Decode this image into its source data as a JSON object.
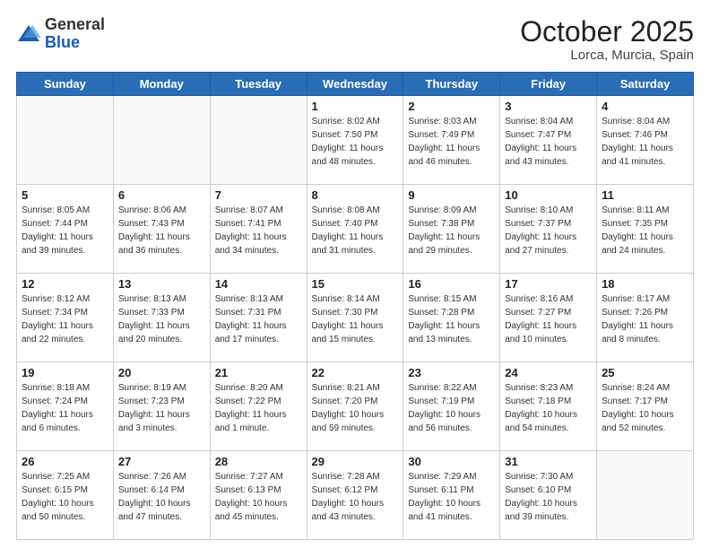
{
  "header": {
    "logo_general": "General",
    "logo_blue": "Blue",
    "month_title": "October 2025",
    "subtitle": "Lorca, Murcia, Spain"
  },
  "days_of_week": [
    "Sunday",
    "Monday",
    "Tuesday",
    "Wednesday",
    "Thursday",
    "Friday",
    "Saturday"
  ],
  "weeks": [
    [
      {
        "day": "",
        "sunrise": "",
        "sunset": "",
        "daylight": ""
      },
      {
        "day": "",
        "sunrise": "",
        "sunset": "",
        "daylight": ""
      },
      {
        "day": "",
        "sunrise": "",
        "sunset": "",
        "daylight": ""
      },
      {
        "day": "1",
        "sunrise": "Sunrise: 8:02 AM",
        "sunset": "Sunset: 7:50 PM",
        "daylight": "Daylight: 11 hours and 48 minutes."
      },
      {
        "day": "2",
        "sunrise": "Sunrise: 8:03 AM",
        "sunset": "Sunset: 7:49 PM",
        "daylight": "Daylight: 11 hours and 46 minutes."
      },
      {
        "day": "3",
        "sunrise": "Sunrise: 8:04 AM",
        "sunset": "Sunset: 7:47 PM",
        "daylight": "Daylight: 11 hours and 43 minutes."
      },
      {
        "day": "4",
        "sunrise": "Sunrise: 8:04 AM",
        "sunset": "Sunset: 7:46 PM",
        "daylight": "Daylight: 11 hours and 41 minutes."
      }
    ],
    [
      {
        "day": "5",
        "sunrise": "Sunrise: 8:05 AM",
        "sunset": "Sunset: 7:44 PM",
        "daylight": "Daylight: 11 hours and 39 minutes."
      },
      {
        "day": "6",
        "sunrise": "Sunrise: 8:06 AM",
        "sunset": "Sunset: 7:43 PM",
        "daylight": "Daylight: 11 hours and 36 minutes."
      },
      {
        "day": "7",
        "sunrise": "Sunrise: 8:07 AM",
        "sunset": "Sunset: 7:41 PM",
        "daylight": "Daylight: 11 hours and 34 minutes."
      },
      {
        "day": "8",
        "sunrise": "Sunrise: 8:08 AM",
        "sunset": "Sunset: 7:40 PM",
        "daylight": "Daylight: 11 hours and 31 minutes."
      },
      {
        "day": "9",
        "sunrise": "Sunrise: 8:09 AM",
        "sunset": "Sunset: 7:38 PM",
        "daylight": "Daylight: 11 hours and 29 minutes."
      },
      {
        "day": "10",
        "sunrise": "Sunrise: 8:10 AM",
        "sunset": "Sunset: 7:37 PM",
        "daylight": "Daylight: 11 hours and 27 minutes."
      },
      {
        "day": "11",
        "sunrise": "Sunrise: 8:11 AM",
        "sunset": "Sunset: 7:35 PM",
        "daylight": "Daylight: 11 hours and 24 minutes."
      }
    ],
    [
      {
        "day": "12",
        "sunrise": "Sunrise: 8:12 AM",
        "sunset": "Sunset: 7:34 PM",
        "daylight": "Daylight: 11 hours and 22 minutes."
      },
      {
        "day": "13",
        "sunrise": "Sunrise: 8:13 AM",
        "sunset": "Sunset: 7:33 PM",
        "daylight": "Daylight: 11 hours and 20 minutes."
      },
      {
        "day": "14",
        "sunrise": "Sunrise: 8:13 AM",
        "sunset": "Sunset: 7:31 PM",
        "daylight": "Daylight: 11 hours and 17 minutes."
      },
      {
        "day": "15",
        "sunrise": "Sunrise: 8:14 AM",
        "sunset": "Sunset: 7:30 PM",
        "daylight": "Daylight: 11 hours and 15 minutes."
      },
      {
        "day": "16",
        "sunrise": "Sunrise: 8:15 AM",
        "sunset": "Sunset: 7:28 PM",
        "daylight": "Daylight: 11 hours and 13 minutes."
      },
      {
        "day": "17",
        "sunrise": "Sunrise: 8:16 AM",
        "sunset": "Sunset: 7:27 PM",
        "daylight": "Daylight: 11 hours and 10 minutes."
      },
      {
        "day": "18",
        "sunrise": "Sunrise: 8:17 AM",
        "sunset": "Sunset: 7:26 PM",
        "daylight": "Daylight: 11 hours and 8 minutes."
      }
    ],
    [
      {
        "day": "19",
        "sunrise": "Sunrise: 8:18 AM",
        "sunset": "Sunset: 7:24 PM",
        "daylight": "Daylight: 11 hours and 6 minutes."
      },
      {
        "day": "20",
        "sunrise": "Sunrise: 8:19 AM",
        "sunset": "Sunset: 7:23 PM",
        "daylight": "Daylight: 11 hours and 3 minutes."
      },
      {
        "day": "21",
        "sunrise": "Sunrise: 8:20 AM",
        "sunset": "Sunset: 7:22 PM",
        "daylight": "Daylight: 11 hours and 1 minute."
      },
      {
        "day": "22",
        "sunrise": "Sunrise: 8:21 AM",
        "sunset": "Sunset: 7:20 PM",
        "daylight": "Daylight: 10 hours and 59 minutes."
      },
      {
        "day": "23",
        "sunrise": "Sunrise: 8:22 AM",
        "sunset": "Sunset: 7:19 PM",
        "daylight": "Daylight: 10 hours and 56 minutes."
      },
      {
        "day": "24",
        "sunrise": "Sunrise: 8:23 AM",
        "sunset": "Sunset: 7:18 PM",
        "daylight": "Daylight: 10 hours and 54 minutes."
      },
      {
        "day": "25",
        "sunrise": "Sunrise: 8:24 AM",
        "sunset": "Sunset: 7:17 PM",
        "daylight": "Daylight: 10 hours and 52 minutes."
      }
    ],
    [
      {
        "day": "26",
        "sunrise": "Sunrise: 7:25 AM",
        "sunset": "Sunset: 6:15 PM",
        "daylight": "Daylight: 10 hours and 50 minutes."
      },
      {
        "day": "27",
        "sunrise": "Sunrise: 7:26 AM",
        "sunset": "Sunset: 6:14 PM",
        "daylight": "Daylight: 10 hours and 47 minutes."
      },
      {
        "day": "28",
        "sunrise": "Sunrise: 7:27 AM",
        "sunset": "Sunset: 6:13 PM",
        "daylight": "Daylight: 10 hours and 45 minutes."
      },
      {
        "day": "29",
        "sunrise": "Sunrise: 7:28 AM",
        "sunset": "Sunset: 6:12 PM",
        "daylight": "Daylight: 10 hours and 43 minutes."
      },
      {
        "day": "30",
        "sunrise": "Sunrise: 7:29 AM",
        "sunset": "Sunset: 6:11 PM",
        "daylight": "Daylight: 10 hours and 41 minutes."
      },
      {
        "day": "31",
        "sunrise": "Sunrise: 7:30 AM",
        "sunset": "Sunset: 6:10 PM",
        "daylight": "Daylight: 10 hours and 39 minutes."
      },
      {
        "day": "",
        "sunrise": "",
        "sunset": "",
        "daylight": ""
      }
    ]
  ]
}
